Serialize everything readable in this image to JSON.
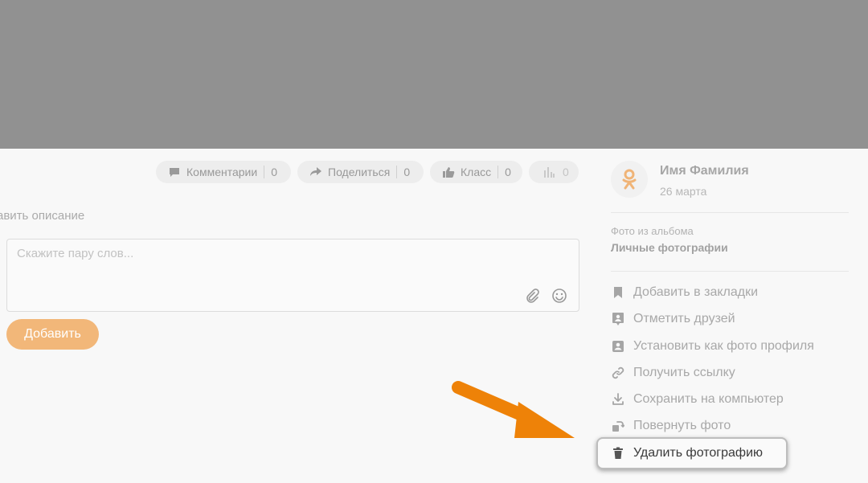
{
  "actions": {
    "comments": {
      "label": "Комментарии",
      "count": "0"
    },
    "share": {
      "label": "Поделиться",
      "count": "0"
    },
    "class": {
      "label": "Класс",
      "count": "0"
    },
    "stats": {
      "count": "0"
    }
  },
  "description": {
    "add_label": "авить описание"
  },
  "comment": {
    "placeholder": "Скажите пару слов...",
    "submit_label": "Добавить"
  },
  "author": {
    "name": "Имя Фамилия",
    "date": "26 марта"
  },
  "album": {
    "label": "Фото из альбома",
    "name": "Личные фотографии"
  },
  "menu": {
    "items": [
      {
        "label": "Добавить в закладки",
        "icon": "bookmark-icon"
      },
      {
        "label": "Отметить друзей",
        "icon": "tag-friend-icon"
      },
      {
        "label": "Установить как фото профиля",
        "icon": "profile-photo-icon"
      },
      {
        "label": "Получить ссылку",
        "icon": "link-icon"
      },
      {
        "label": "Сохранить на компьютер",
        "icon": "download-icon"
      },
      {
        "label": "Повернуть фото",
        "icon": "rotate-icon"
      },
      {
        "label": "Удалить фотографию",
        "icon": "trash-icon"
      }
    ]
  },
  "colors": {
    "accent": "#f2b779",
    "highlight_arrow": "#ee8208",
    "photo_placeholder": "#919191"
  }
}
